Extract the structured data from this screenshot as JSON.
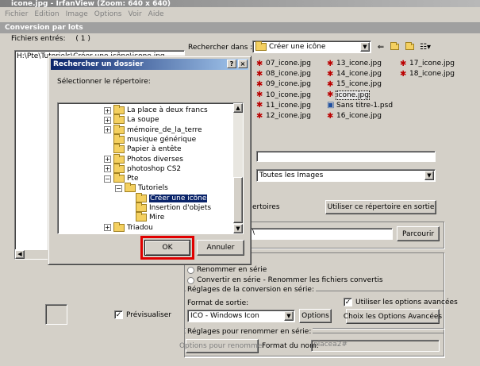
{
  "app": {
    "title": "icone.jpg - IrfanView (Zoom: 640 x 640)",
    "menu": [
      "Fichier",
      "Edition",
      "Image",
      "Options",
      "Voir",
      "Aide"
    ]
  },
  "batch": {
    "title": "Conversion par lots",
    "files_count_label": "Fichiers entrés:",
    "files_count": "( 1 )",
    "input_path": "H:\\Pte\\Tutoriels\\Créer une icône\\icone.jpg",
    "look_in_label": "Rechercher dans :",
    "look_in_value": "Créer une icône",
    "files": [
      [
        "07_icone.jpg",
        "08_icone.jpg",
        "09_icone.jpg",
        "10_icone.jpg",
        "11_icone.jpg",
        "12_icone.jpg"
      ],
      [
        "13_icone.jpg",
        "14_icone.jpg",
        "15_icone.jpg",
        "icone.jpg",
        "Sans titre-1.psd",
        "16_icone.jpg"
      ],
      [
        "17_icone.jpg",
        "18_icone.jpg"
      ]
    ],
    "file_type_value": "Toutes les Images",
    "directory_label_partial": "ertoires",
    "use_dir_button": "Utiliser ce répertoire en sortie",
    "output_dir_value": "\\",
    "browse_button": "Parcourir",
    "radio_rename": "Renommer en série",
    "radio_convert_rename": "Convertir en série - Renommer les fichiers convertis",
    "conversion_group": "Réglages de la conversion en série:",
    "output_format_label": "Format de sortie:",
    "output_format_value": "ICO - Windows Icon",
    "options_button": "Options",
    "use_advanced_label": "Utiliser les options avancées",
    "advanced_button": "Choix les Options Avancées",
    "rename_group": "Réglages pour renommer en série:",
    "rename_options_button": "Options pour renommer",
    "name_format_label": "Format du nom:",
    "name_format_value": "placea2#",
    "preview_label": "Prévisualiser"
  },
  "dialog": {
    "title": "Rechercher un dossier",
    "help": "?",
    "close": "×",
    "prompt": "Sélectionner le répertoire:",
    "tree": [
      {
        "label": "La place à deux francs",
        "expander": "+",
        "indent": 0
      },
      {
        "label": "La soupe",
        "expander": "+",
        "indent": 0
      },
      {
        "label": "mémoire_de_la_terre",
        "expander": "+",
        "indent": 0
      },
      {
        "label": "musique générique",
        "expander": "",
        "indent": 0
      },
      {
        "label": "Papier à entête",
        "expander": "",
        "indent": 0
      },
      {
        "label": "Photos diverses",
        "expander": "+",
        "indent": 0
      },
      {
        "label": "photoshop CS2",
        "expander": "+",
        "indent": 0
      },
      {
        "label": "Pte",
        "expander": "−",
        "indent": 0
      },
      {
        "label": "Tutoriels",
        "expander": "−",
        "indent": 1
      },
      {
        "label": "Créer une icône",
        "expander": "",
        "indent": 2,
        "selected": true
      },
      {
        "label": "Insertion d'objets",
        "expander": "",
        "indent": 2
      },
      {
        "label": "Mire",
        "expander": "",
        "indent": 2
      },
      {
        "label": "Triadou",
        "expander": "+",
        "indent": 0
      }
    ],
    "ok": "OK",
    "cancel": "Annuler"
  },
  "colors": {
    "highlight": "#0a246a",
    "ok_outline": "#e00000",
    "title_grad_start": "#0a246a"
  }
}
